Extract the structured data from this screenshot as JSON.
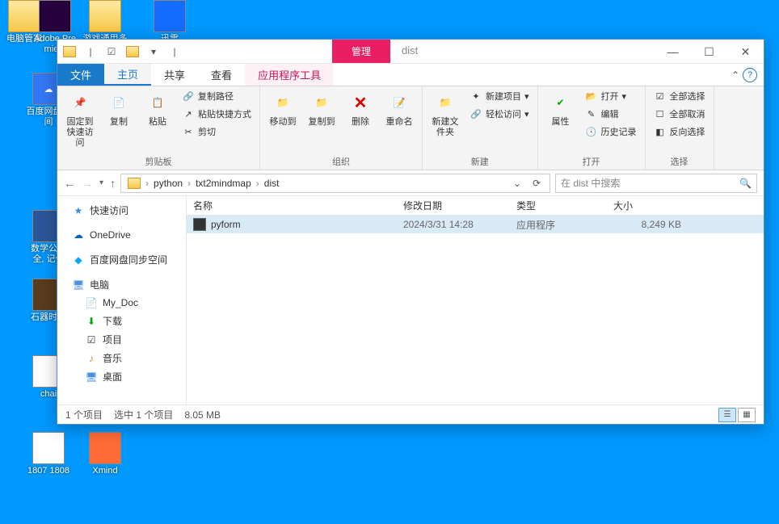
{
  "desktop": {
    "icons": [
      {
        "label": "电脑管家"
      },
      {
        "label": "Adobe Premie..."
      },
      {
        "label": "游戏通用多开器"
      },
      {
        "label": "迅雷"
      },
      {
        "label": "百度网盘空间"
      },
      {
        "label": "数学公式 全, 记住"
      },
      {
        "label": "石器时代"
      },
      {
        "label": "chai"
      },
      {
        "label": "1807 1808"
      },
      {
        "label": "Xmind"
      }
    ]
  },
  "window": {
    "tab_context": "管理",
    "title": "dist",
    "ribbon_tabs": {
      "file": "文件",
      "home": "主页",
      "share": "共享",
      "view": "查看",
      "apptools": "应用程序工具"
    },
    "breadcrumb": [
      "python",
      "txt2mindmap",
      "dist"
    ],
    "search_placeholder": "在 dist 中搜索"
  },
  "ribbon": {
    "clipboard": {
      "pin": "固定到快速访问",
      "copy": "复制",
      "paste": "粘贴",
      "copypath": "复制路径",
      "pasteshortcut": "粘贴快捷方式",
      "cut": "剪切",
      "group": "剪贴板"
    },
    "organize": {
      "moveto": "移动到",
      "copyto": "复制到",
      "delete": "删除",
      "rename": "重命名",
      "group": "组织"
    },
    "new": {
      "newfolder": "新建文件夹",
      "newitem": "新建项目",
      "easyaccess": "轻松访问",
      "group": "新建"
    },
    "open": {
      "properties": "属性",
      "open": "打开",
      "edit": "编辑",
      "history": "历史记录",
      "group": "打开"
    },
    "select": {
      "selectall": "全部选择",
      "selectnone": "全部取消",
      "invert": "反向选择",
      "group": "选择"
    }
  },
  "nav": {
    "quickaccess": "快速访问",
    "onedrive": "OneDrive",
    "baidupan": "百度网盘同步空间",
    "thispc": "电脑",
    "mydoc": "My_Doc",
    "downloads": "下载",
    "projects": "项目",
    "music": "音乐",
    "desktop": "桌面"
  },
  "columns": {
    "name": "名称",
    "date": "修改日期",
    "type": "类型",
    "size": "大小"
  },
  "files": [
    {
      "name": "pyform",
      "date": "2024/3/31 14:28",
      "type": "应用程序",
      "size": "8,249 KB"
    }
  ],
  "status": {
    "count": "1 个项目",
    "selection": "选中 1 个项目",
    "size": "8.05 MB"
  }
}
